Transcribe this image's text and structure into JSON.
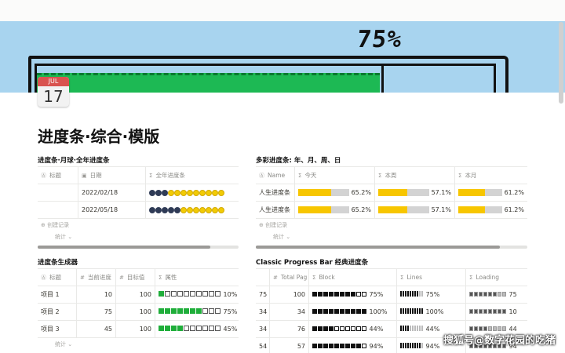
{
  "cover": {
    "percent_label": "75%"
  },
  "calendar": {
    "month": "JUL",
    "day": "17"
  },
  "page_title": "进度条·综合·模版",
  "sections": {
    "yearly": {
      "title": "进度条·月球·全年进度条",
      "headers": [
        "标题",
        "日期",
        "全年进度条"
      ],
      "rows": [
        {
          "title": "",
          "date": "2022/02/18",
          "dark": 3,
          "light": 9
        },
        {
          "title": "",
          "date": "2022/05/18",
          "dark": 5,
          "light": 7
        }
      ],
      "create_label": "创建记录",
      "stats_label": "统计"
    },
    "colorful": {
      "title": "多彩进度条: 年、月、周、日",
      "headers": [
        "Name",
        "今天",
        "本周",
        "本月"
      ],
      "rows": [
        {
          "name": "人生进度条",
          "today": "65.2%",
          "week": "57.1%",
          "month": "61.2%",
          "today_v": 65.2,
          "week_v": 57.1,
          "month_v": 61.2
        },
        {
          "name": "人生进度条",
          "today": "65.2%",
          "week": "57.1%",
          "month": "61.2%",
          "today_v": 65.2,
          "week_v": 57.1,
          "month_v": 61.2
        }
      ],
      "create_label": "创建记录",
      "stats_label": "统计"
    },
    "generator": {
      "title": "进度条生成器",
      "headers": [
        "标题",
        "当前进度",
        "目标值",
        "属性"
      ],
      "rows": [
        {
          "title": "项目 1",
          "current": "10",
          "target": "100",
          "pct": "10%",
          "on": 1
        },
        {
          "title": "项目 2",
          "current": "75",
          "target": "100",
          "pct": "75%",
          "on": 7
        },
        {
          "title": "项目 3",
          "current": "45",
          "target": "100",
          "pct": "45%",
          "on": 4
        }
      ],
      "stats_label": "统计"
    },
    "classic": {
      "title": "Classic Progress Bar 经典进度条",
      "headers": [
        "",
        "Total Pag",
        "Block",
        "Lines",
        "Loading"
      ],
      "rows": [
        {
          "a": "75",
          "total": "100",
          "block": "75%",
          "lines": "75%",
          "loading": "75",
          "v": 75
        },
        {
          "a": "34",
          "total": "34",
          "block": "100%",
          "lines": "100%",
          "loading": "10",
          "v": 100
        },
        {
          "a": "34",
          "total": "76",
          "block": "44%",
          "lines": "44%",
          "loading": "44",
          "v": 44
        },
        {
          "a": "54",
          "total": "57",
          "block": "94%",
          "lines": "94%",
          "loading": "94",
          "v": 94
        }
      ]
    }
  },
  "watermark": "搜狐号@数字花园的吃猪"
}
